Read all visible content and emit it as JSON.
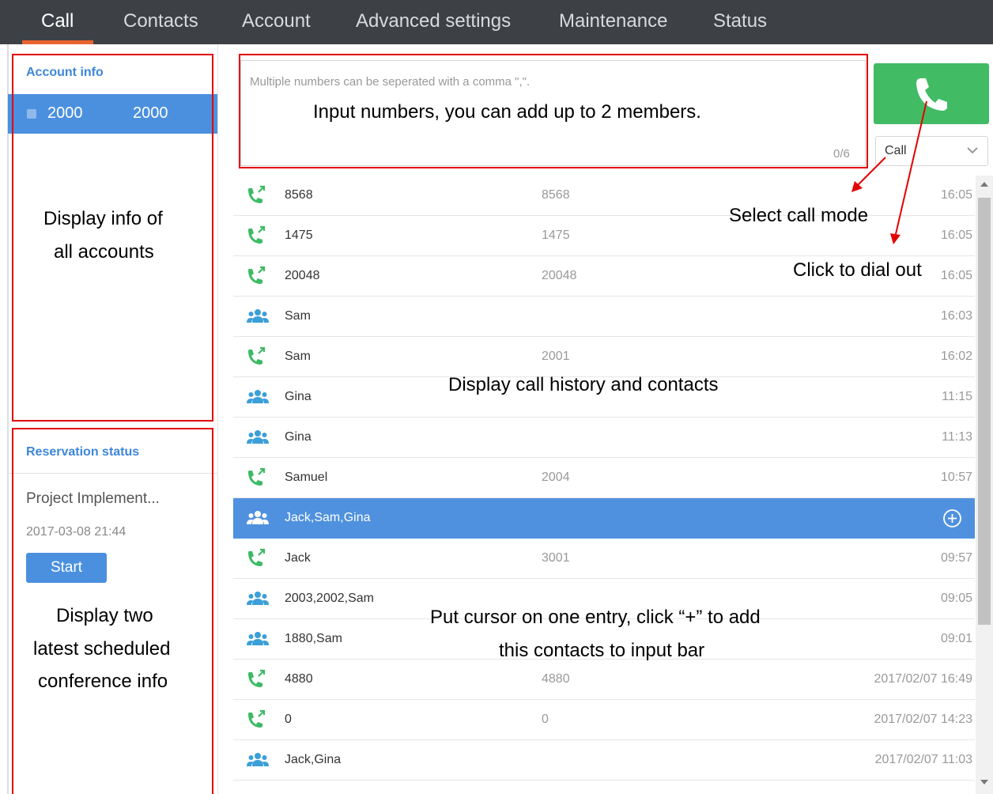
{
  "nav": {
    "tabs": [
      {
        "label": "Call",
        "active": true
      },
      {
        "label": "Contacts",
        "active": false
      },
      {
        "label": "Account",
        "active": false
      },
      {
        "label": "Advanced settings",
        "active": false
      },
      {
        "label": "Maintenance",
        "active": false
      },
      {
        "label": "Status",
        "active": false
      }
    ]
  },
  "accounts": {
    "title": "Account info",
    "items": [
      {
        "number": "2000",
        "name": "2000"
      }
    ]
  },
  "reservation": {
    "title": "Reservation status",
    "meeting_title": "Project Implement...",
    "meeting_time": "2017-03-08 21:44",
    "start_label": "Start"
  },
  "input": {
    "placeholder": "Multiple numbers can be seperated with a comma \",\".",
    "counter": "0/6"
  },
  "call_mode": {
    "selected": "Call"
  },
  "history": [
    {
      "type": "call",
      "name": "8568",
      "number": "8568",
      "time": "16:05"
    },
    {
      "type": "call",
      "name": "1475",
      "number": "1475",
      "time": "16:05"
    },
    {
      "type": "call",
      "name": "20048",
      "number": "20048",
      "time": "16:05"
    },
    {
      "type": "conference",
      "name": "Sam",
      "number": "",
      "time": "16:03"
    },
    {
      "type": "call",
      "name": "Sam",
      "number": "2001",
      "time": "16:02"
    },
    {
      "type": "conference",
      "name": "Gina",
      "number": "",
      "time": "11:15"
    },
    {
      "type": "conference",
      "name": "Gina",
      "number": "",
      "time": "11:13"
    },
    {
      "type": "call",
      "name": "Samuel",
      "number": "2004",
      "time": "10:57"
    },
    {
      "type": "conference",
      "name": "Jack,Sam,Gina",
      "number": "",
      "time": "",
      "selected": true
    },
    {
      "type": "call",
      "name": "Jack",
      "number": "3001",
      "time": "09:57"
    },
    {
      "type": "conference",
      "name": "2003,2002,Sam",
      "number": "",
      "time": "09:05"
    },
    {
      "type": "conference",
      "name": "1880,Sam",
      "number": "",
      "time": "09:01"
    },
    {
      "type": "call",
      "name": "4880",
      "number": "4880",
      "time": "2017/02/07 16:49"
    },
    {
      "type": "call",
      "name": "0",
      "number": "0",
      "time": "2017/02/07 14:23"
    },
    {
      "type": "conference",
      "name": "Jack,Gina",
      "number": "",
      "time": "2017/02/07 11:03"
    }
  ],
  "annotations": {
    "input_hint": "Input numbers, you can add up to 2 members.",
    "accounts_hint_1": "Display info of",
    "accounts_hint_2": "all accounts",
    "reservation_hint_1": "Display two",
    "reservation_hint_2": "latest scheduled",
    "reservation_hint_3": "conference info",
    "call_mode_hint": "Select call mode",
    "dial_hint": "Click to dial out",
    "history_hint": "Display call history and contacts",
    "add_hint_1": "Put cursor on one entry, click “+” to add",
    "add_hint_2": "this contacts to input bar"
  },
  "colors": {
    "nav_bg": "#3d4146",
    "accent_blue": "#4b90df",
    "call_green": "#42bb65",
    "conference_blue": "#3b9fd8",
    "annotation_red": "#e30000"
  },
  "icons": {
    "call": "phone-icon",
    "conference": "group-icon",
    "add": "plus-circle-icon",
    "mode": "chevron-down-icon"
  }
}
